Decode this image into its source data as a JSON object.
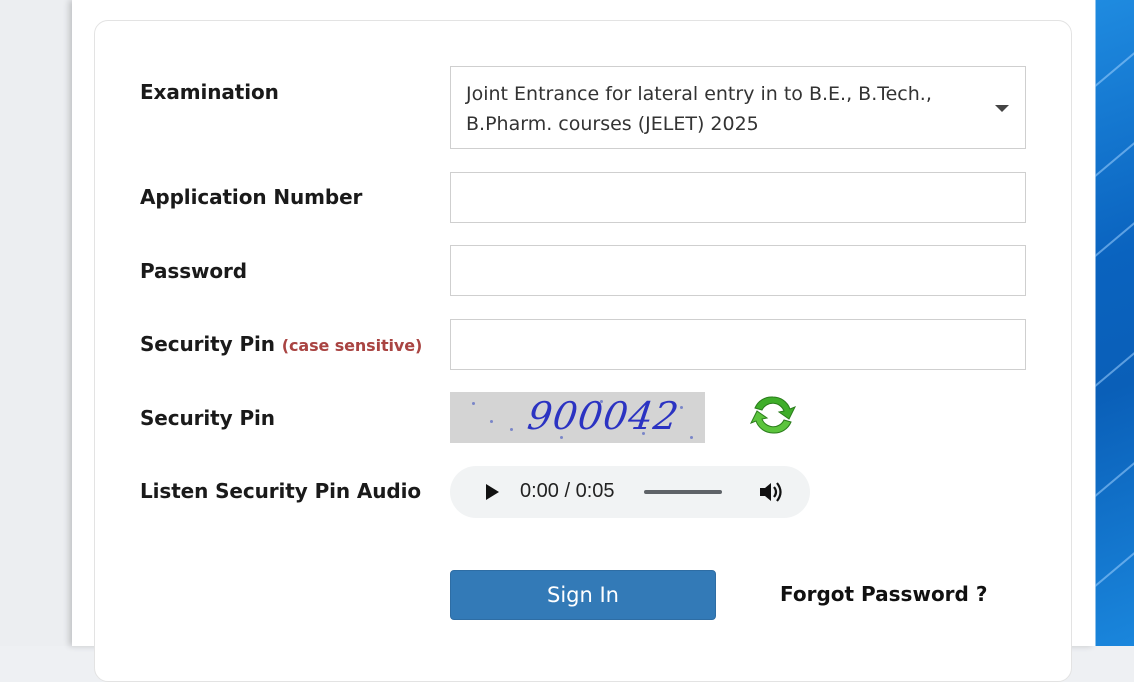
{
  "form": {
    "examination_label": "Examination",
    "examination_value": "Joint Entrance for lateral entry in to B.E., B.Tech., B.Pharm. courses (JELET) 2025",
    "application_number_label": "Application Number",
    "application_number_value": "",
    "password_label": "Password",
    "password_value": "",
    "security_pin_input_label": "Security Pin",
    "security_pin_hint": "(case sensitive)",
    "security_pin_value": "",
    "security_pin_captcha_label": "Security Pin",
    "captcha_text": "900042",
    "audio_label": "Listen Security Pin Audio",
    "audio_time": "0:00 / 0:05",
    "sign_in_label": "Sign In",
    "forgot_password_label": "Forgot Password ?"
  },
  "colors": {
    "primary_button": "#337ab7",
    "hint_text": "#a94442",
    "captcha_digits": "#2b33c2",
    "refresh_icon": "#3fae2a"
  },
  "icons": {
    "dropdown": "caret-down-icon",
    "refresh": "refresh-icon",
    "play": "play-icon",
    "volume": "volume-icon"
  }
}
